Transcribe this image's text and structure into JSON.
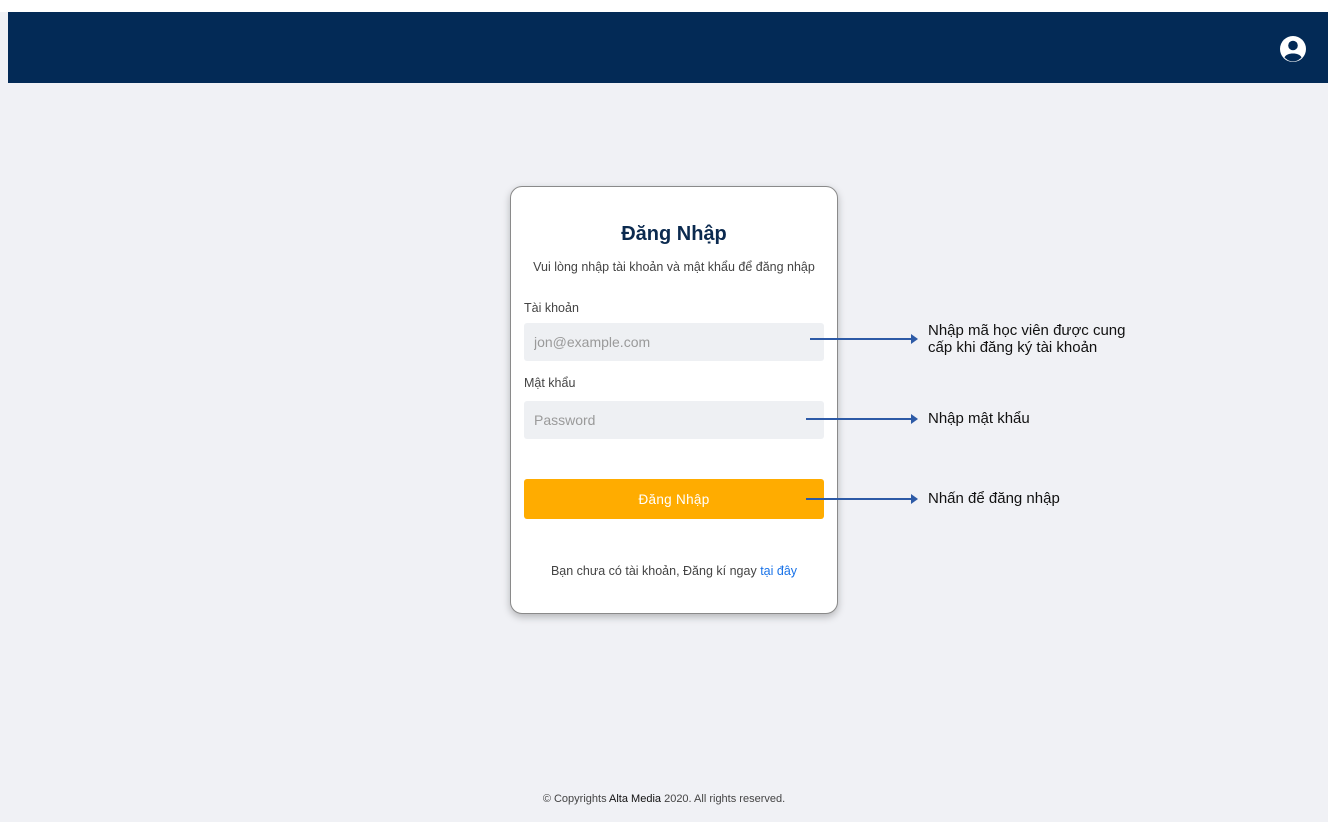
{
  "navbar": {
    "bg_color": "#032a56",
    "account_icon": "user-circle-icon"
  },
  "login": {
    "title": "Đăng Nhập",
    "subtitle": "Vui lòng nhập tài khoản và mật khẩu để đăng nhập",
    "username_label": "Tài khoản",
    "username_placeholder": "jon@example.com",
    "username_value": "",
    "password_label": "Mật khẩu",
    "password_placeholder": "Password",
    "password_value": "",
    "submit_label": "Đăng Nhập",
    "submit_color": "#ffac00",
    "signup_text": "Bạn chưa có tài khoản, Đăng kí ngay",
    "signup_link": "tại đây"
  },
  "annotations": {
    "username_line1": "Nhập mã học viên được cung",
    "username_line2": "cấp khi đăng ký tài khoản",
    "password": "Nhập mật khẩu",
    "submit": "Nhấn để đăng nhập",
    "arrow_color": "#2d5aa6"
  },
  "footer": {
    "prefix": "© Copyrights",
    "brand": "Alta Media",
    "suffix": "2020. All rights reserved."
  }
}
